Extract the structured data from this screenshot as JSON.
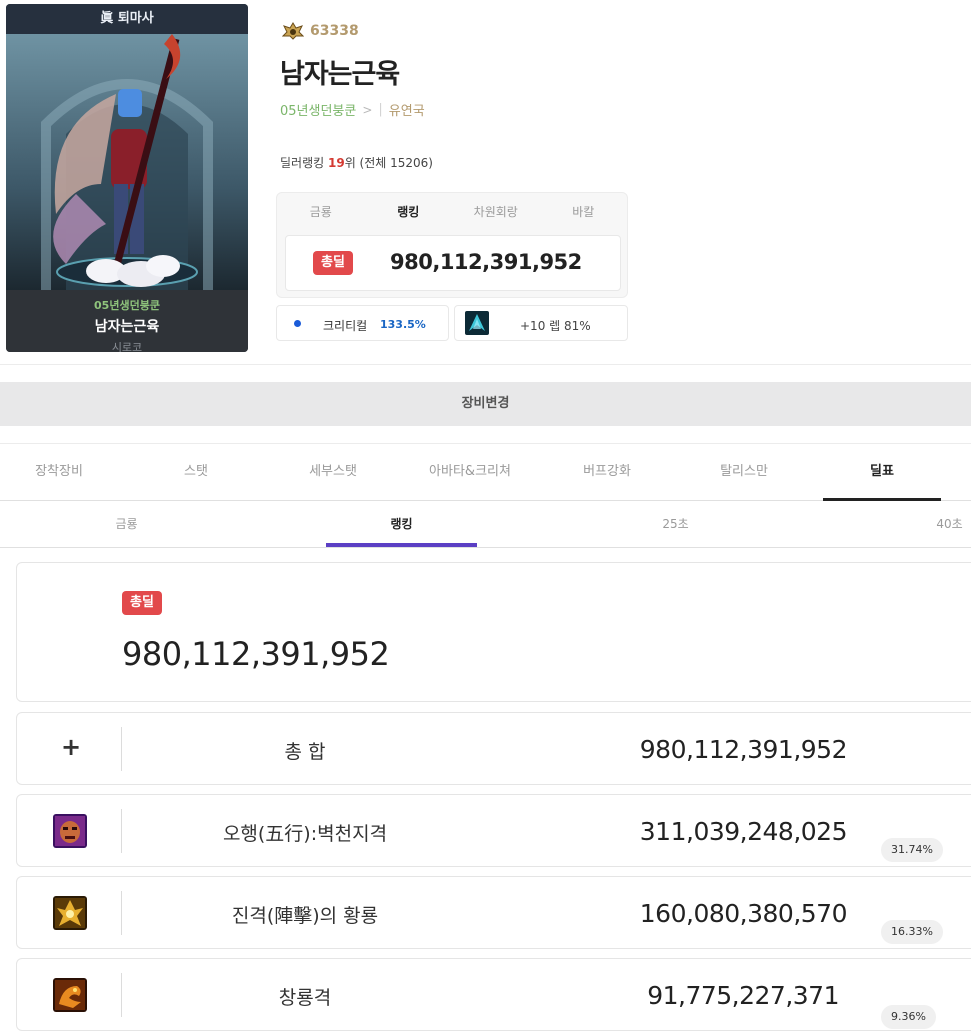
{
  "character": {
    "job": "眞 퇴마사",
    "guild": "05년생던붕쿤",
    "name": "남자는근육",
    "server": "시로코"
  },
  "profile": {
    "fame": "63338",
    "name": "남자는근육",
    "guild": "05년생던붕쿤",
    "adventure": "유연국",
    "dealer_rank_prefix": "딜러랭킹",
    "dealer_rank_value": "19",
    "dealer_rank_suffix": "위 (전체 15206)"
  },
  "rank_box": {
    "tabs": [
      "금룡",
      "랭킹",
      "차원회랑",
      "바칼"
    ],
    "active_tab": "랭킹",
    "badge": "총딜",
    "value": "980,112,391,952"
  },
  "stats": {
    "crit_label": "크리티컬",
    "crit_value": "133.5%",
    "weapon_label": "+10 렙 81%"
  },
  "equip_change": "장비변경",
  "main_tabs": [
    "장착장비",
    "스탯",
    "세부스탯",
    "아바타&크리쳐",
    "버프강화",
    "탈리스만",
    "딜표"
  ],
  "main_tab_active": "딜표",
  "sub_tabs": [
    "금룡",
    "랭킹",
    "25초",
    "40초"
  ],
  "sub_tab_active": "랭킹",
  "total": {
    "badge": "총딜",
    "value": "980,112,391,952"
  },
  "rows": [
    {
      "name": "총 합",
      "value": "980,112,391,952",
      "percent": "",
      "icon": "plus-icon"
    },
    {
      "name": "오행(五行):벽천지격",
      "value": "311,039,248,025",
      "percent": "31.74%",
      "icon": "demon-face-skill-icon"
    },
    {
      "name": "진격(陣擊)의 황룡",
      "value": "160,080,380,570",
      "percent": "16.33%",
      "icon": "golden-dragon-skill-icon"
    },
    {
      "name": "창룡격",
      "value": "91,775,227,371",
      "percent": "9.36%",
      "icon": "dragon-strike-skill-icon"
    }
  ],
  "colors": {
    "badge_red": "#e2494b",
    "sub_tab_underline": "#5b3fc4",
    "crit_blue": "#1a66c4",
    "guild_green": "#7bb66a"
  }
}
